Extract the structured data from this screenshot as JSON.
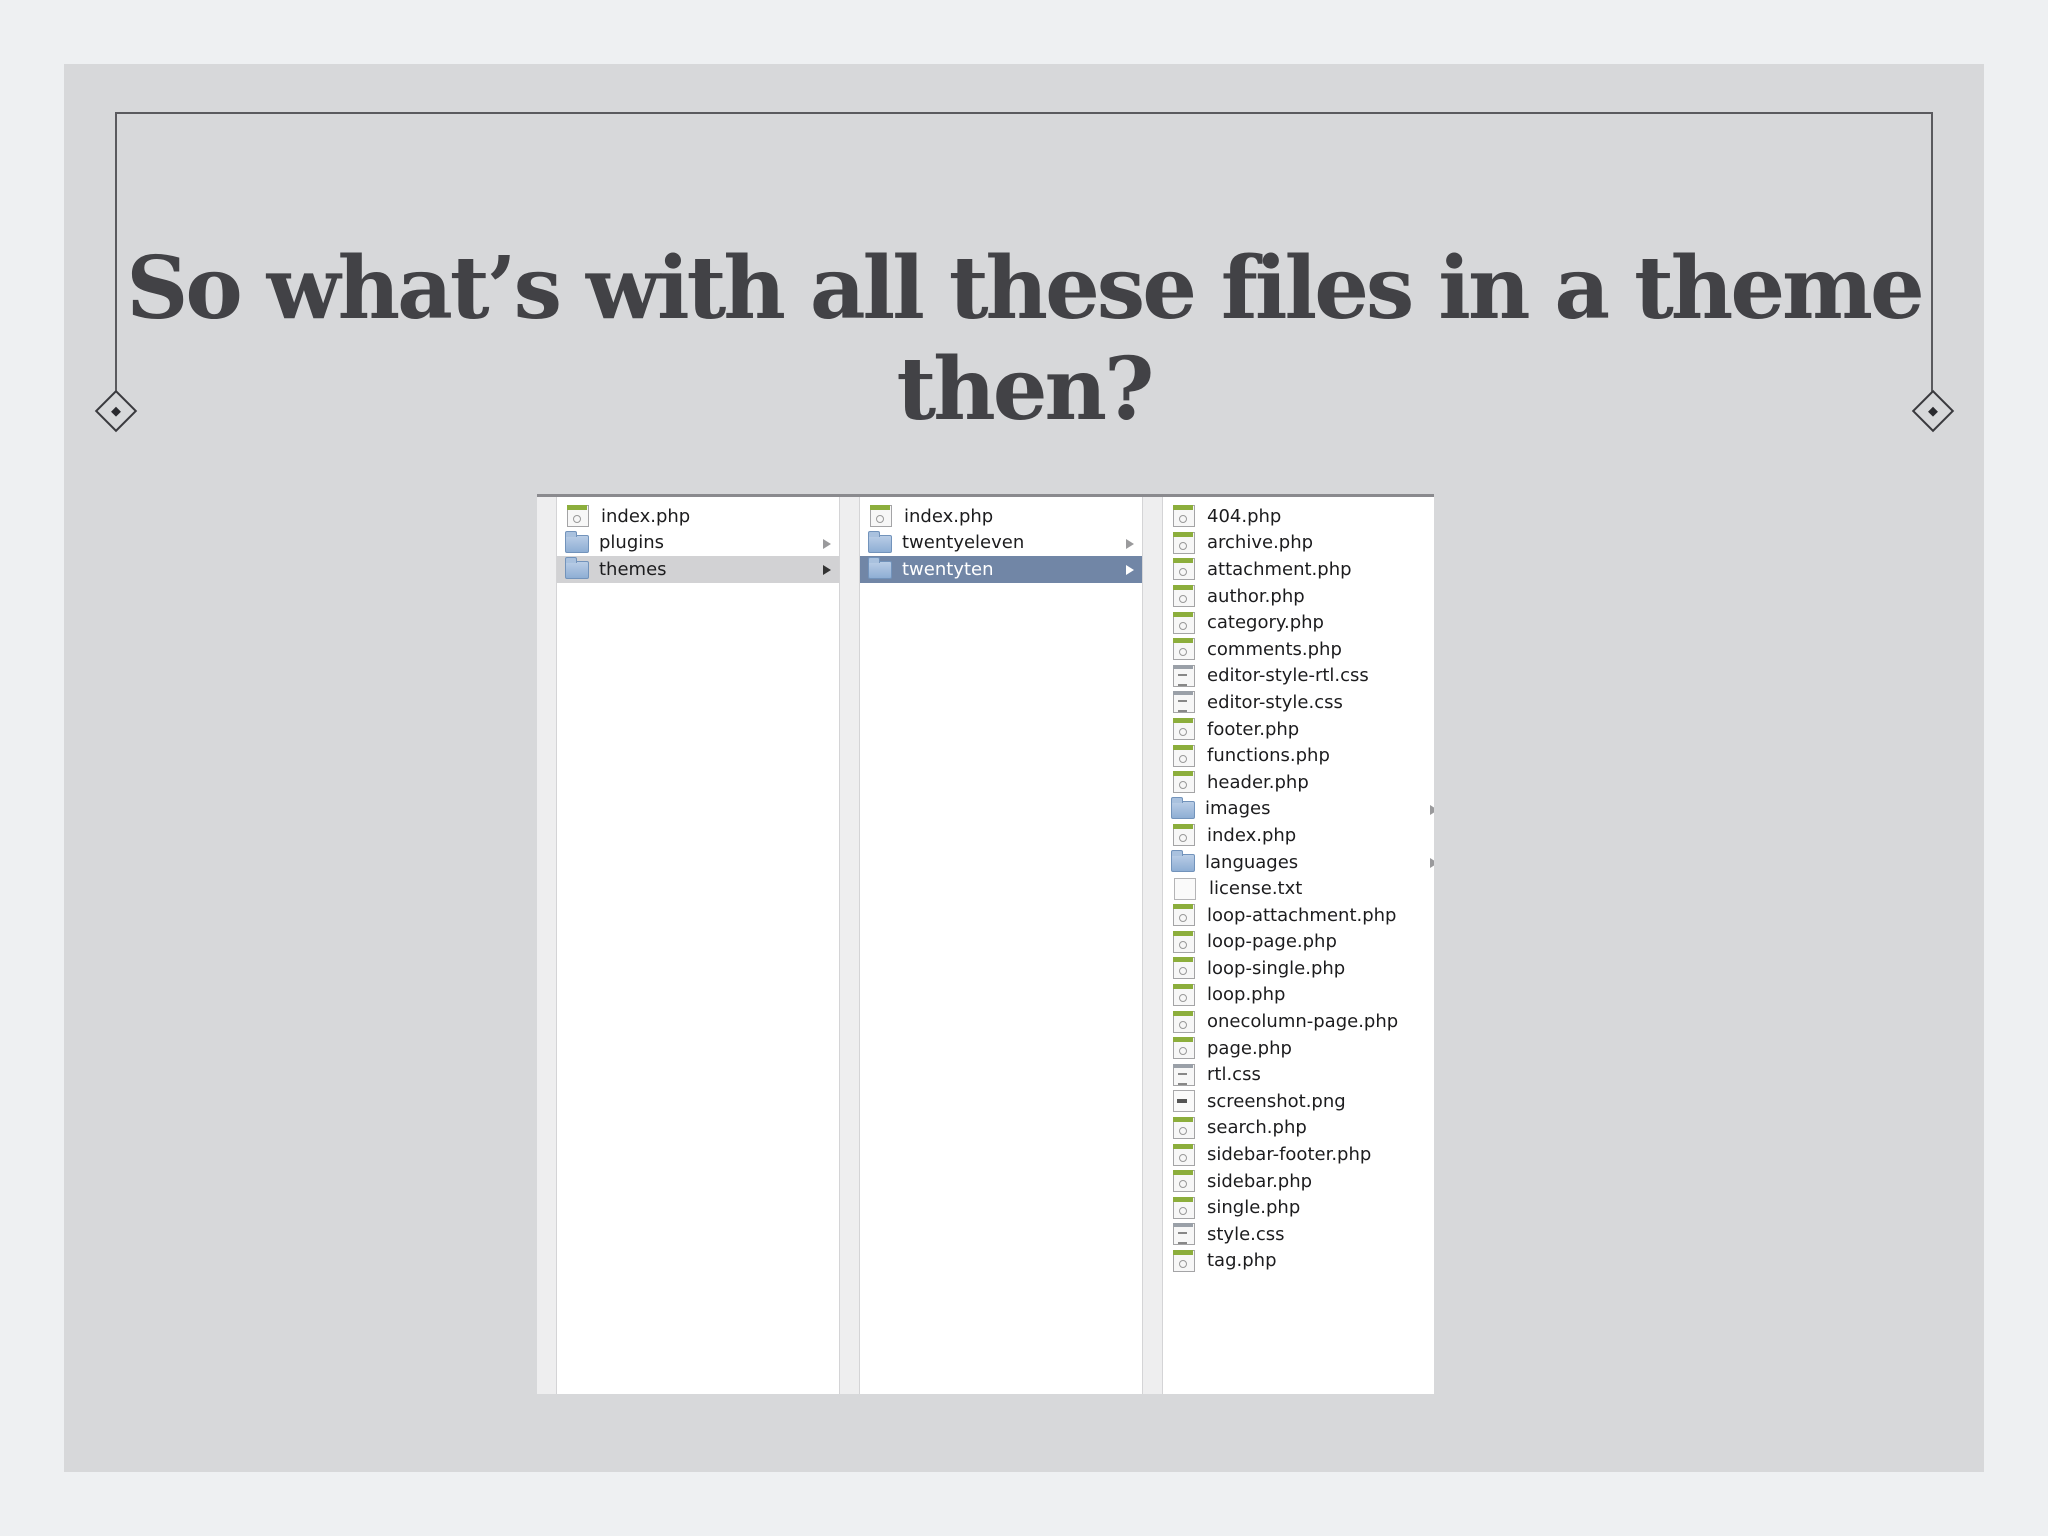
{
  "slide": {
    "title": "So what’s with all these files in a theme then?"
  },
  "finder": {
    "columns": [
      {
        "items": [
          {
            "name": "index.php",
            "type": "php",
            "has_children": false,
            "selected": false
          },
          {
            "name": "plugins",
            "type": "folder",
            "has_children": true,
            "selected": false
          },
          {
            "name": "themes",
            "type": "folder",
            "has_children": true,
            "selected": "path"
          }
        ]
      },
      {
        "items": [
          {
            "name": "index.php",
            "type": "php",
            "has_children": false,
            "selected": false
          },
          {
            "name": "twentyeleven",
            "type": "folder",
            "has_children": true,
            "selected": false
          },
          {
            "name": "twentyten",
            "type": "folder",
            "has_children": true,
            "selected": "active"
          }
        ]
      },
      {
        "items": [
          {
            "name": "404.php",
            "type": "php",
            "has_children": false
          },
          {
            "name": "archive.php",
            "type": "php",
            "has_children": false
          },
          {
            "name": "attachment.php",
            "type": "php",
            "has_children": false
          },
          {
            "name": "author.php",
            "type": "php",
            "has_children": false
          },
          {
            "name": "category.php",
            "type": "php",
            "has_children": false
          },
          {
            "name": "comments.php",
            "type": "php",
            "has_children": false
          },
          {
            "name": "editor-style-rtl.css",
            "type": "css",
            "has_children": false
          },
          {
            "name": "editor-style.css",
            "type": "css",
            "has_children": false
          },
          {
            "name": "footer.php",
            "type": "php",
            "has_children": false
          },
          {
            "name": "functions.php",
            "type": "php",
            "has_children": false
          },
          {
            "name": "header.php",
            "type": "php",
            "has_children": false
          },
          {
            "name": "images",
            "type": "folder",
            "has_children": true
          },
          {
            "name": "index.php",
            "type": "php",
            "has_children": false
          },
          {
            "name": "languages",
            "type": "folder",
            "has_children": true
          },
          {
            "name": "license.txt",
            "type": "txt",
            "has_children": false
          },
          {
            "name": "loop-attachment.php",
            "type": "php",
            "has_children": false
          },
          {
            "name": "loop-page.php",
            "type": "php",
            "has_children": false
          },
          {
            "name": "loop-single.php",
            "type": "php",
            "has_children": false
          },
          {
            "name": "loop.php",
            "type": "php",
            "has_children": false
          },
          {
            "name": "onecolumn-page.php",
            "type": "php",
            "has_children": false
          },
          {
            "name": "page.php",
            "type": "php",
            "has_children": false
          },
          {
            "name": "rtl.css",
            "type": "css",
            "has_children": false
          },
          {
            "name": "screenshot.png",
            "type": "png",
            "has_children": false
          },
          {
            "name": "search.php",
            "type": "php",
            "has_children": false
          },
          {
            "name": "sidebar-footer.php",
            "type": "php",
            "has_children": false
          },
          {
            "name": "sidebar.php",
            "type": "php",
            "has_children": false
          },
          {
            "name": "single.php",
            "type": "php",
            "has_children": false
          },
          {
            "name": "style.css",
            "type": "css",
            "has_children": false
          },
          {
            "name": "tag.php",
            "type": "php",
            "has_children": false
          }
        ]
      }
    ]
  },
  "colors": {
    "slide_bg": "#d7d8da",
    "title_text": "#424246",
    "selection_active": "#7186a6",
    "selection_path": "#d2d2d4",
    "php_icon_band": "#8cae3c",
    "folder_blue": "#8eaed4"
  },
  "icons": {
    "php": "php-file-icon",
    "css": "css-file-icon",
    "txt": "text-file-icon",
    "png": "image-file-icon",
    "folder": "folder-icon",
    "arrow": "disclosure-arrow-icon"
  }
}
